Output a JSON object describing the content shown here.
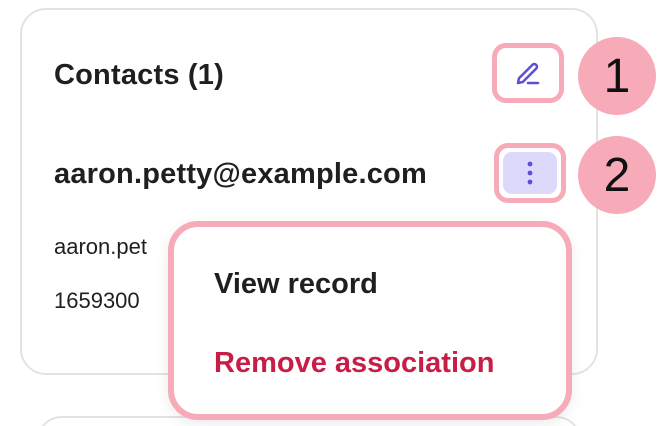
{
  "contacts": {
    "title": "Contacts (1)",
    "edit_icon": "pencil-icon",
    "contact": {
      "email_heading": "aaron.petty@example.com",
      "email_detail": "aaron.pet",
      "phone_detail": "1659300",
      "more_icon": "vertical-ellipsis-icon"
    }
  },
  "annotations": {
    "badge_1": "1",
    "badge_2": "2"
  },
  "menu": {
    "items": [
      {
        "label": "View record"
      },
      {
        "label": "Remove association"
      }
    ]
  },
  "colors": {
    "accent": "#5b4fd6",
    "highlight": "#f7aab8",
    "danger": "#c81d47",
    "more_button_bg": "#dcd9fb"
  }
}
